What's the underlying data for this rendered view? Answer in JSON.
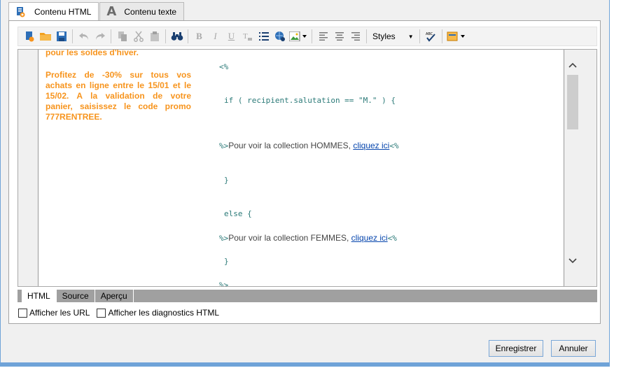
{
  "tabs": [
    {
      "label": "Contenu HTML",
      "active": true,
      "icon": "html-doc-icon"
    },
    {
      "label": "Contenu texte",
      "active": false,
      "icon": "letter-a-icon"
    }
  ],
  "toolbar": {
    "bold": "B",
    "italic": "I",
    "underline": "U",
    "styles_label": "Styles"
  },
  "editor": {
    "promo_top": "pour les soldes d'hiver.",
    "promo_body": "Profitez de -30% sur tous vos achats en ligne entre le 15/01 et le 15/02. A la validation de votre panier, saisissez le code promo 777RENTREE.",
    "code": {
      "open_tag": "<%",
      "if_line": "if ( recipient.salutation == \"M.\" ) {",
      "hommes_prefix": "%>",
      "hommes_text": "Pour voir la collection HOMMES, ",
      "hommes_link": "cliquez ici",
      "hommes_suffix": "<%",
      "brace1": "}",
      "else_line": "else {",
      "femmes_prefix": "%>",
      "femmes_text": "Pour voir la collection FEMMES, ",
      "femmes_link": "cliquez ici",
      "femmes_suffix": "<%",
      "brace2": "}",
      "close_tag": "%>"
    }
  },
  "modes": [
    {
      "label": "HTML",
      "active": true
    },
    {
      "label": "Source",
      "active": false
    },
    {
      "label": "Aperçu",
      "active": false
    }
  ],
  "options": {
    "show_urls": "Afficher les URL",
    "show_diagnostics": "Afficher les diagnostics HTML"
  },
  "buttons": {
    "save": "Enregistrer",
    "cancel": "Annuler"
  },
  "colors": {
    "accent": "#6fa3d8",
    "promo_text": "#f7941d",
    "code_text": "#2b7a78",
    "link": "#0645ad"
  }
}
